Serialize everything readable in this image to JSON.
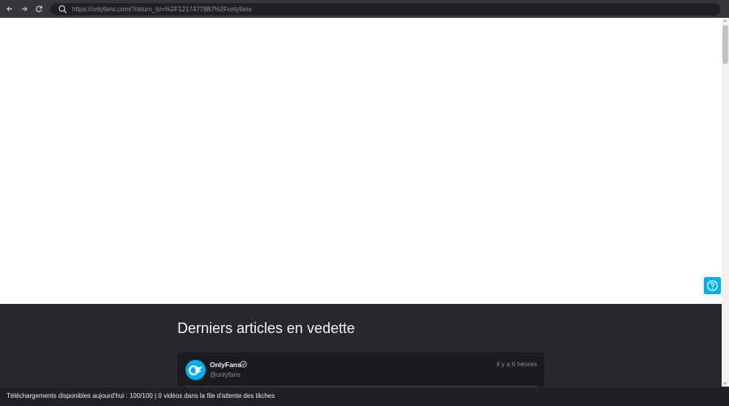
{
  "browser": {
    "url": "https://onlyfans.com/?return_to=%2F1217477887%2Fonlyfans",
    "icons": [
      "back-icon",
      "forward-icon",
      "reload-icon",
      "search-icon"
    ]
  },
  "featured": {
    "title": "Derniers articles en vedette",
    "post": {
      "name": "OnlyFans",
      "handle": "@onlyfans",
      "time": "il y a 6 heures"
    }
  },
  "help": {
    "icon": "help-icon"
  },
  "status": {
    "text": "Téléchargements disponibles aujourd'hui : 100/100 | 0 vidéos dans la file d'attente des tâches"
  },
  "colors": {
    "brand": "#00aff0",
    "toolbar": "#35363a",
    "dark_section": "#27282d",
    "card": "#1a1b1f"
  }
}
